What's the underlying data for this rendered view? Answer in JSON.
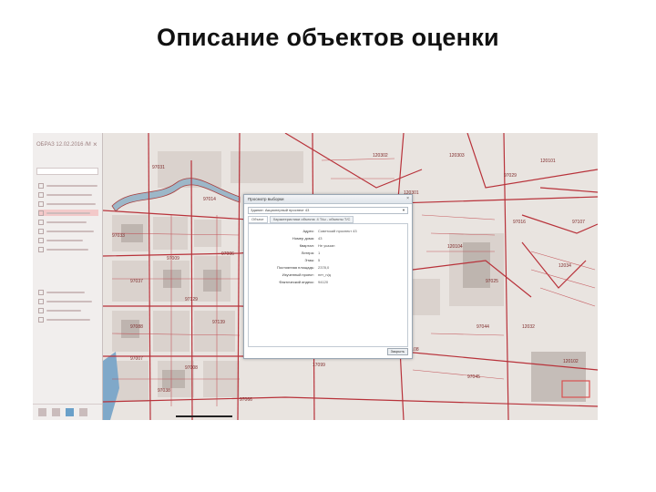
{
  "slide": {
    "title": "Описание объектов оценки"
  },
  "left_panel": {
    "header": "ОБРАЗ 12.02.2016 /М",
    "close": "×",
    "tools": [
      "hand-tool",
      "layers-tool",
      "info-tool",
      "settings-tool"
    ]
  },
  "dialog": {
    "title": "Просмотр выборки",
    "close": "×",
    "select_value": "Здание: Акционерный проспект 43",
    "tabs": [
      "Объект",
      "Характеристики объекта: 4 Т/ш - объекты Т/С"
    ],
    "properties": [
      {
        "label": "Адрес:",
        "value": "Советский проспект 43"
      },
      {
        "label": "Номер дома:",
        "value": "43"
      },
      {
        "label": "Квартал:",
        "value": "Не указан"
      },
      {
        "label": "Литера:",
        "value": "1"
      },
      {
        "label": "Этаж:",
        "value": "5"
      },
      {
        "label": "Постоянная площадь:",
        "value": "2378,0"
      },
      {
        "label": "Изученный проект:",
        "value": "нет_н/д"
      },
      {
        "label": "Фактический индекс:",
        "value": "94120"
      }
    ],
    "close_button": "Закрыть"
  },
  "map": {
    "labels": [
      "97031",
      "120302",
      "120303",
      "97014",
      "120301",
      "120104",
      "97029",
      "120101",
      "97107",
      "97016",
      "12034",
      "97033",
      "97009",
      "97006",
      "97037",
      "97129",
      "97088",
      "97139",
      "97007",
      "97008",
      "97006",
      "97038",
      "120108",
      "97044",
      "120102",
      "12032",
      "97098",
      "97066",
      "97045",
      "17099",
      "97025"
    ]
  },
  "colors": {
    "road": "#b8323a",
    "block": "#d9d2cc",
    "water": "#6a9ec4",
    "highlight": "#d95050"
  }
}
